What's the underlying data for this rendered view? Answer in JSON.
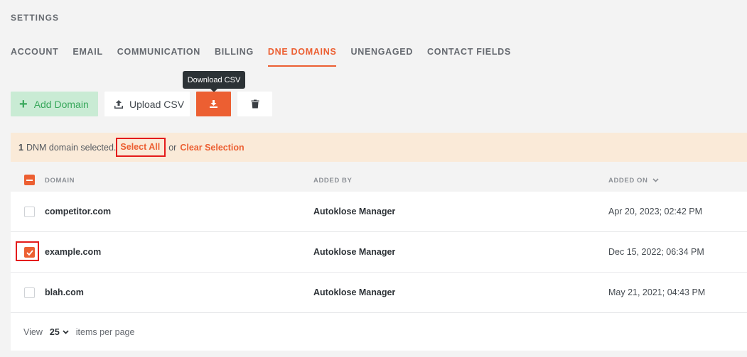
{
  "page": {
    "heading": "SETTINGS"
  },
  "tabs": [
    {
      "label": "ACCOUNT",
      "active": false
    },
    {
      "label": "EMAIL",
      "active": false
    },
    {
      "label": "COMMUNICATION",
      "active": false
    },
    {
      "label": "BILLING",
      "active": false
    },
    {
      "label": "DNE DOMAINS",
      "active": true
    },
    {
      "label": "UNENGAGED",
      "active": false
    },
    {
      "label": "CONTACT FIELDS",
      "active": false
    }
  ],
  "toolbar": {
    "add_label": "Add Domain",
    "upload_label": "Upload CSV",
    "download_tooltip": "Download CSV",
    "icons": {
      "add": "plus-icon",
      "upload": "upload-icon",
      "download": "download-icon",
      "delete": "trash-icon"
    }
  },
  "selection": {
    "count": "1",
    "message": "DNM domain selected.",
    "select_all": "Select All",
    "or": "or",
    "clear": "Clear Selection"
  },
  "table": {
    "columns": {
      "domain": "DOMAIN",
      "added_by": "ADDED BY",
      "added_on": "ADDED ON"
    },
    "rows": [
      {
        "domain": "competitor.com",
        "added_by": "Autoklose Manager",
        "added_on": "Apr 20, 2023; 02:42 PM",
        "selected": false
      },
      {
        "domain": "example.com",
        "added_by": "Autoklose Manager",
        "added_on": "Dec 15, 2022; 06:34 PM",
        "selected": true
      },
      {
        "domain": "blah.com",
        "added_by": "Autoklose Manager",
        "added_on": "May 21, 2021; 04:43 PM",
        "selected": false
      }
    ]
  },
  "pager": {
    "view_label": "View",
    "page_size": "25",
    "suffix": "items per page"
  },
  "colors": {
    "accent": "#ec5f32",
    "add_bg": "#c9ebd4",
    "add_fg": "#39a85c",
    "banner_bg": "#faead8",
    "highlight": "#e41b1b"
  }
}
